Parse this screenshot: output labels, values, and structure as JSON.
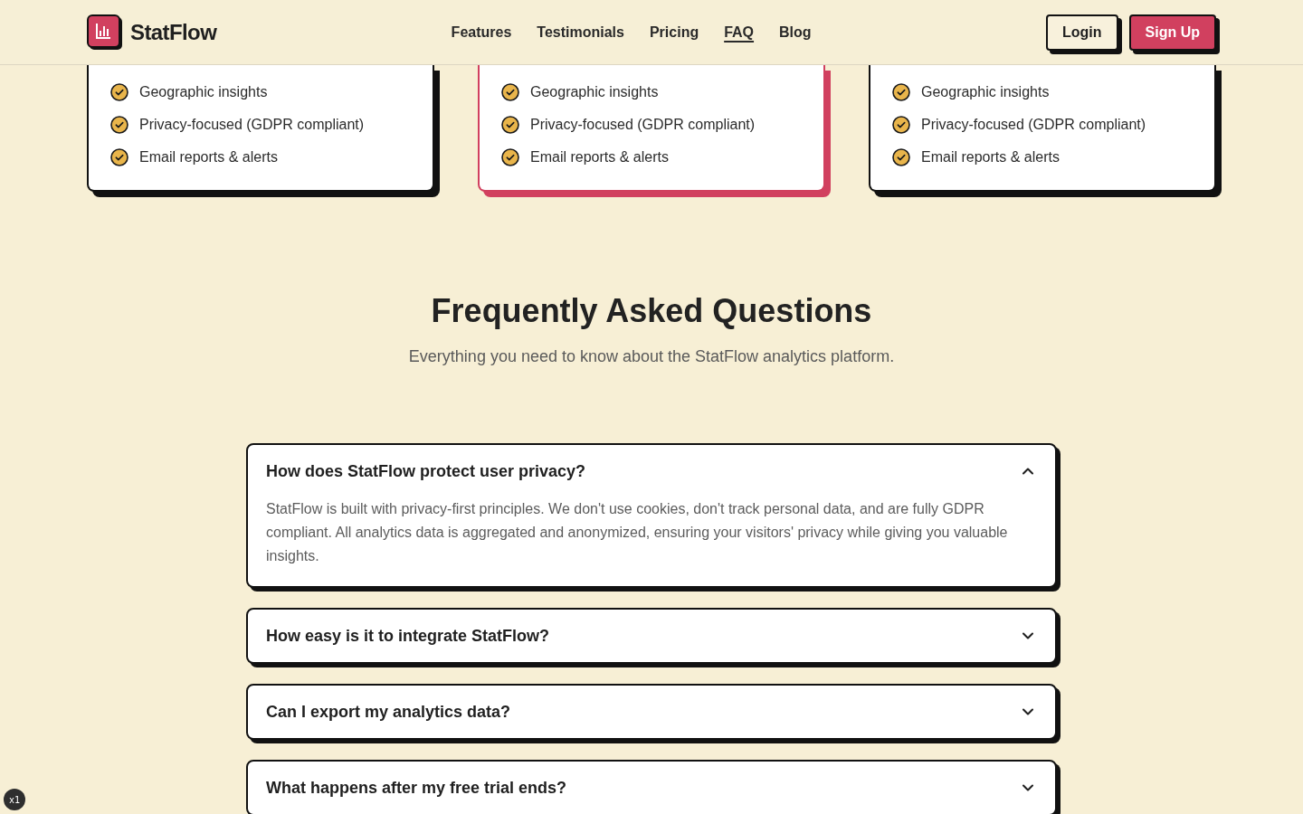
{
  "header": {
    "brand": "StatFlow",
    "nav": [
      {
        "label": "Features",
        "selected": false
      },
      {
        "label": "Testimonials",
        "selected": false
      },
      {
        "label": "Pricing",
        "selected": false
      },
      {
        "label": "FAQ",
        "selected": true
      },
      {
        "label": "Blog",
        "selected": false
      }
    ],
    "buttons": [
      {
        "label": "Login",
        "kind": "outline"
      },
      {
        "label": "Sign Up",
        "kind": "primary"
      }
    ]
  },
  "pricing_cards": [
    {
      "highlighted": false,
      "features": [
        "Geographic insights",
        "Privacy-focused (GDPR compliant)",
        "Email reports & alerts"
      ]
    },
    {
      "highlighted": true,
      "features": [
        "Geographic insights",
        "Privacy-focused (GDPR compliant)",
        "Email reports & alerts"
      ]
    },
    {
      "highlighted": false,
      "features": [
        "Geographic insights",
        "Privacy-focused (GDPR compliant)",
        "Email reports & alerts"
      ]
    }
  ],
  "faq": {
    "title": "Frequently Asked Questions",
    "subtitle": "Everything you need to know about the StatFlow analytics platform.",
    "items": [
      {
        "question": "How does StatFlow protect user privacy?",
        "expanded": true,
        "answer": "StatFlow is built with privacy-first principles. We don't use cookies, don't track personal data, and are fully GDPR compliant. All analytics data is aggregated and anonymized, ensuring your visitors' privacy while giving you valuable insights."
      },
      {
        "question": "How easy is it to integrate StatFlow?",
        "expanded": false
      },
      {
        "question": "Can I export my analytics data?",
        "expanded": false
      },
      {
        "question": "What happens after my free trial ends?",
        "expanded": false
      }
    ]
  },
  "overlay_badge": "x1"
}
